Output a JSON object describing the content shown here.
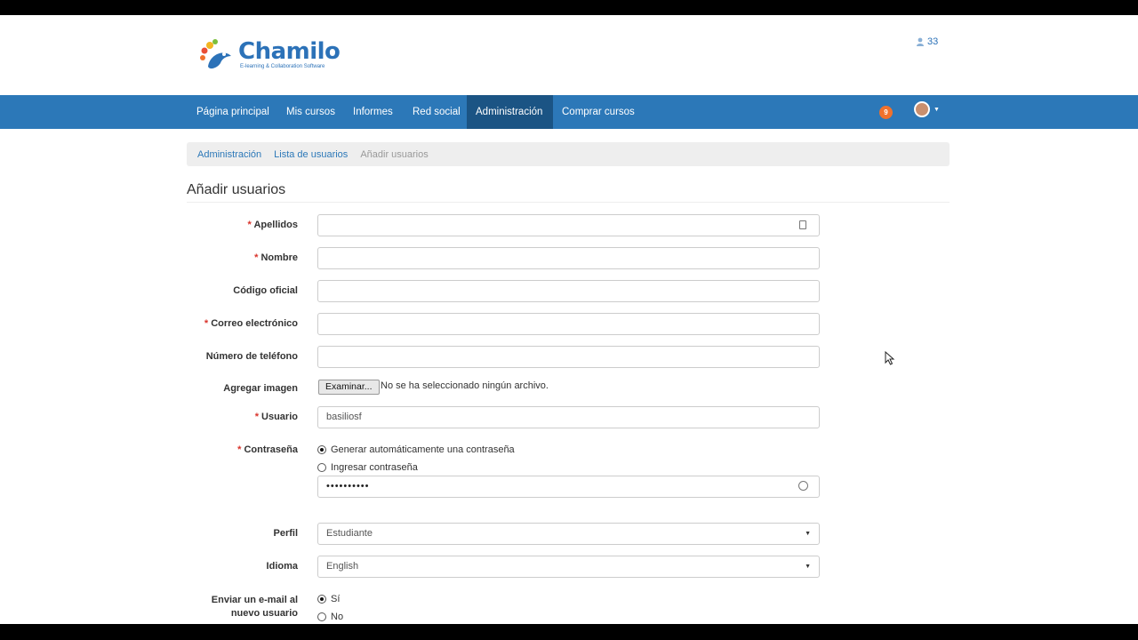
{
  "header": {
    "logo_title": "Chamilo",
    "logo_subtitle": "E-learning & Collaboration Software",
    "online_count": "33"
  },
  "navbar": {
    "items": [
      {
        "label": "Página principal"
      },
      {
        "label": "Mis cursos"
      },
      {
        "label": "Informes"
      },
      {
        "label": "Red social"
      },
      {
        "label": "Administración",
        "active": true
      },
      {
        "label": "Comprar cursos"
      }
    ],
    "notification_count": "9"
  },
  "breadcrumb": {
    "items": [
      "Administración",
      "Lista de usuarios",
      "Añadir usuarios"
    ]
  },
  "page_title": "Añadir usuarios",
  "form": {
    "apellidos": {
      "label": "Apellidos",
      "value": ""
    },
    "nombre": {
      "label": "Nombre",
      "value": ""
    },
    "codigo": {
      "label": "Código oficial",
      "value": ""
    },
    "correo": {
      "label": "Correo electrónico",
      "value": ""
    },
    "telefono": {
      "label": "Número de teléfono",
      "value": ""
    },
    "imagen": {
      "label": "Agregar imagen",
      "button": "Examinar...",
      "status": "No se ha seleccionado ningún archivo."
    },
    "usuario": {
      "label": "Usuario",
      "value": "basiliosf"
    },
    "contrasena": {
      "label": "Contraseña",
      "option_auto": "Generar automáticamente una contraseña",
      "option_manual": "Ingresar contraseña",
      "value": "••••••••••"
    },
    "perfil": {
      "label": "Perfil",
      "value": "Estudiante"
    },
    "idioma": {
      "label": "Idioma",
      "value": "English"
    },
    "email": {
      "label": "Enviar un e-mail al nuevo usuario",
      "option_yes": "Sí",
      "option_no": "No"
    }
  },
  "colors": {
    "navbar": "#2c78b8",
    "navbar_active": "#1b5484",
    "required": "#d9332b",
    "badge": "#f0712c"
  }
}
